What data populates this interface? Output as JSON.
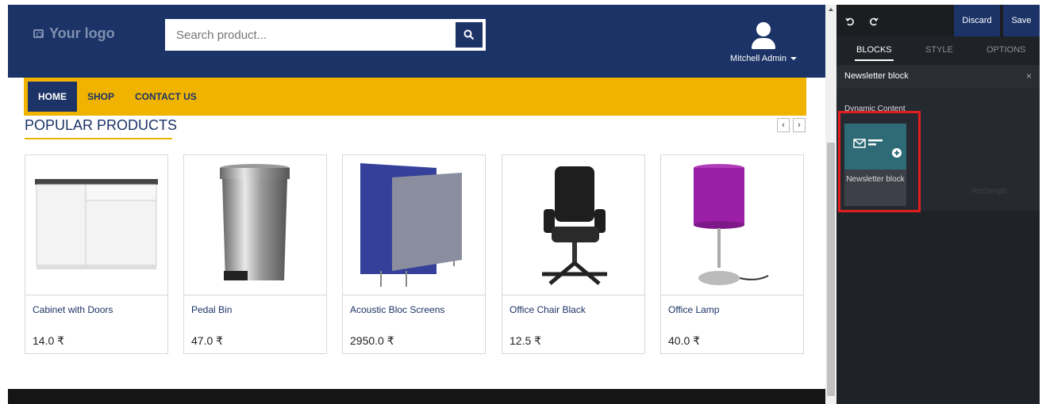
{
  "header": {
    "logo_text": "Your logo",
    "search_placeholder": "Search product...",
    "user_name": "Mitchell Admin"
  },
  "nav": {
    "items": [
      {
        "label": "HOME",
        "active": true
      },
      {
        "label": "SHOP",
        "active": false
      },
      {
        "label": "CONTACT US",
        "active": false
      }
    ]
  },
  "section": {
    "title": "POPULAR PRODUCTS",
    "prev_arrow": "‹",
    "next_arrow": "›"
  },
  "products": [
    {
      "name": "Cabinet with Doors",
      "price": "14.0 ₹"
    },
    {
      "name": "Pedal Bin",
      "price": "47.0 ₹"
    },
    {
      "name": "Acoustic Bloc Screens",
      "price": "2950.0 ₹"
    },
    {
      "name": "Office Chair Black",
      "price": "12.5 ₹"
    },
    {
      "name": "Office Lamp",
      "price": "40.0 ₹"
    }
  ],
  "editor": {
    "undo_icon": "undo-icon",
    "redo_icon": "redo-icon",
    "discard_label": "Discard",
    "save_label": "Save",
    "tabs": [
      {
        "label": "BLOCKS",
        "active": true
      },
      {
        "label": "STYLE",
        "active": false
      },
      {
        "label": "OPTIONS",
        "active": false
      }
    ],
    "block_header": "Newsletter block",
    "close_symbol": "×",
    "category_title": "Dynamic Content",
    "tile_label": "Newsletter block",
    "faded_label": "Rectangle"
  },
  "colors": {
    "brand_dark": "#1b3366",
    "accent_yellow": "#f0b400",
    "highlight_red": "#e01e1e",
    "panel_bg": "#1f2227"
  }
}
